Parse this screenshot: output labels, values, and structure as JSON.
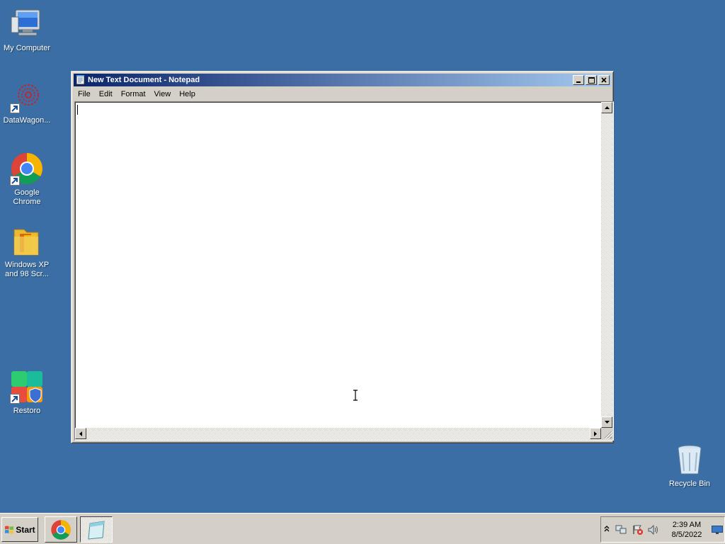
{
  "desktop": {
    "icons": [
      {
        "label": "My Computer",
        "icon": "computer-icon"
      },
      {
        "label": "DataWagon...",
        "icon": "datawagon-icon"
      },
      {
        "label": "Google Chrome",
        "icon": "chrome-icon"
      },
      {
        "label": "Windows XP and 98 Scr...",
        "icon": "folder-icon"
      },
      {
        "label": "Restoro",
        "icon": "restoro-icon"
      },
      {
        "label": "Recycle Bin",
        "icon": "recycle-bin-icon"
      }
    ]
  },
  "window": {
    "title": "New Text Document - Notepad",
    "menu": [
      "File",
      "Edit",
      "Format",
      "View",
      "Help"
    ],
    "content": ""
  },
  "taskbar": {
    "start_label": "Start",
    "apps": [
      {
        "name": "Google Chrome",
        "icon": "chrome-icon",
        "active": false
      },
      {
        "name": "Notepad",
        "icon": "notepad-icon",
        "active": true
      }
    ]
  },
  "tray": {
    "time": "2:39 AM",
    "date": "8/5/2022",
    "icons": [
      "show-hidden-icon",
      "network-icon",
      "action-center-icon",
      "volume-icon",
      "show-desktop-icon"
    ]
  },
  "colors": {
    "desktop": "#3a6ea5",
    "title_start": "#0a246a",
    "title_end": "#a6caf0",
    "chrome": "#d4d0c8"
  }
}
